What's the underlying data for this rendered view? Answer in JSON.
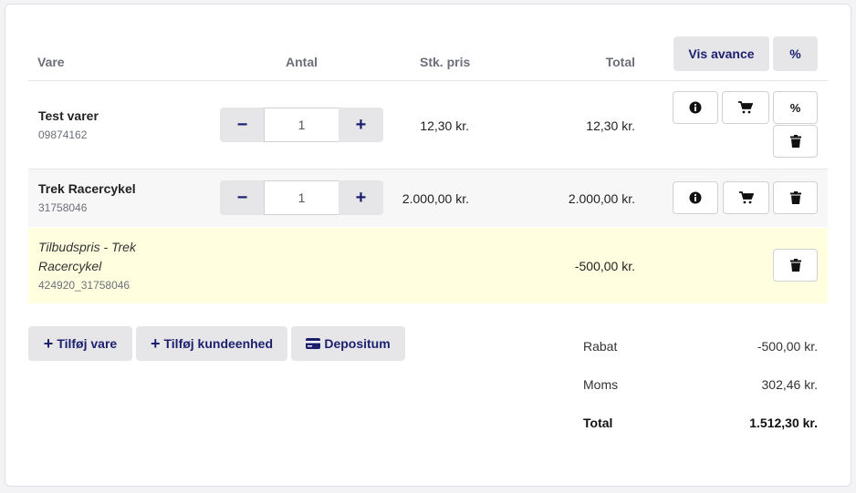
{
  "table": {
    "headers": {
      "item": "Vare",
      "qty": "Antal",
      "unit_price": "Stk. pris",
      "total": "Total"
    },
    "show_margin_label": "Vis avance",
    "percent_label": "%"
  },
  "rows": [
    {
      "name": "Test varer",
      "sku": "09874162",
      "qty": "1",
      "unit_price": "12,30 kr.",
      "total": "12,30 kr."
    },
    {
      "name": "Trek Racercykel",
      "sku": "31758046",
      "qty": "1",
      "unit_price": "2.000,00 kr.",
      "total": "2.000,00 kr."
    }
  ],
  "discount_row": {
    "name_line1": "Tilbudspris - Trek",
    "name_line2": "Racercykel",
    "sku": "424920_31758046",
    "total": "-500,00 kr."
  },
  "row_buttons": {
    "percent": "%",
    "minus": "−",
    "plus": "+"
  },
  "actions": {
    "add_item": "Tilføj vare",
    "add_customer_unit": "Tilføj kundeenhed",
    "deposit": "Depositum",
    "plus_glyph": "+"
  },
  "summary": {
    "discount_label": "Rabat",
    "discount_value": "-500,00 kr.",
    "vat_label": "Moms",
    "vat_value": "302,46 kr.",
    "total_label": "Total",
    "total_value": "1.512,30 kr."
  },
  "colors": {
    "accent": "#1c1f6e",
    "discount_row_bg": "#ffffe0",
    "alt_row_bg": "#f7f7f8"
  }
}
